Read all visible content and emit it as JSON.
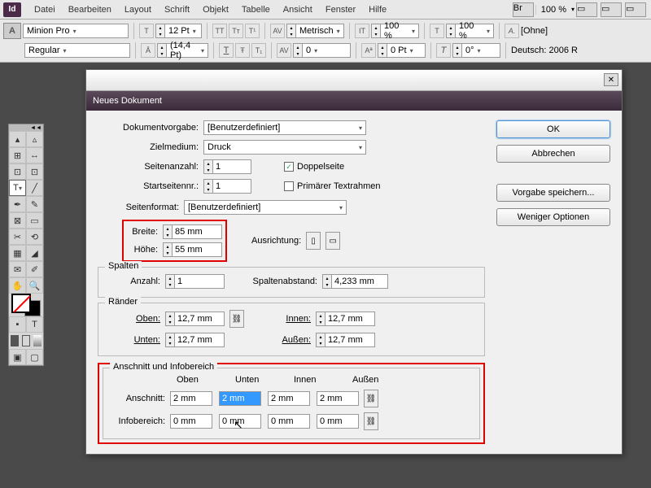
{
  "menu": {
    "items": [
      "Datei",
      "Bearbeiten",
      "Layout",
      "Schrift",
      "Objekt",
      "Tabelle",
      "Ansicht",
      "Fenster",
      "Hilfe"
    ],
    "bridge": "Br",
    "zoom": "100 %"
  },
  "ctrl": {
    "font": "Minion Pro",
    "style": "Regular",
    "size": "12 Pt",
    "leading": "(14,4 Pt)",
    "kerning": "Metrisch",
    "tracking": "0",
    "vscale": "100 %",
    "hscale": "100 %",
    "baseline": "0 Pt",
    "skew": "0°",
    "charstyle": "[Ohne]",
    "lang": "Deutsch: 2006 R"
  },
  "dialog": {
    "title": "Neues Dokument",
    "labels": {
      "preset": "Dokumentvorgabe:",
      "intent": "Zielmedium:",
      "pages": "Seitenanzahl:",
      "start": "Startseitennr.:",
      "facing": "Doppelseite",
      "primary": "Primärer Textrahmen",
      "pagesize": "Seitenformat:",
      "width": "Breite:",
      "height": "Höhe:",
      "orient": "Ausrichtung:",
      "columns": "Spalten",
      "colcount": "Anzahl:",
      "gutter": "Spaltenabstand:",
      "margins": "Ränder",
      "top": "Oben:",
      "bottom": "Unten:",
      "inside": "Innen:",
      "outside": "Außen:",
      "bleed_group": "Anschnitt und Infobereich",
      "col_top": "Oben",
      "col_bottom": "Unten",
      "col_in": "Innen",
      "col_out": "Außen",
      "bleed": "Anschnitt:",
      "slug": "Infobereich:"
    },
    "values": {
      "preset": "[Benutzerdefiniert]",
      "intent": "Druck",
      "pages": "1",
      "start": "1",
      "facing": true,
      "primary": false,
      "pagesize": "[Benutzerdefiniert]",
      "width": "85 mm",
      "height": "55 mm",
      "colcount": "1",
      "gutter": "4,233 mm",
      "m_top": "12,7 mm",
      "m_bottom": "12,7 mm",
      "m_in": "12,7 mm",
      "m_out": "12,7 mm",
      "bleed": [
        "2 mm",
        "2 mm",
        "2 mm",
        "2 mm"
      ],
      "slug": [
        "0 mm",
        "0 mm",
        "0 mm",
        "0 mm"
      ]
    },
    "buttons": {
      "ok": "OK",
      "cancel": "Abbrechen",
      "save": "Vorgabe speichern...",
      "less": "Weniger Optionen"
    }
  }
}
